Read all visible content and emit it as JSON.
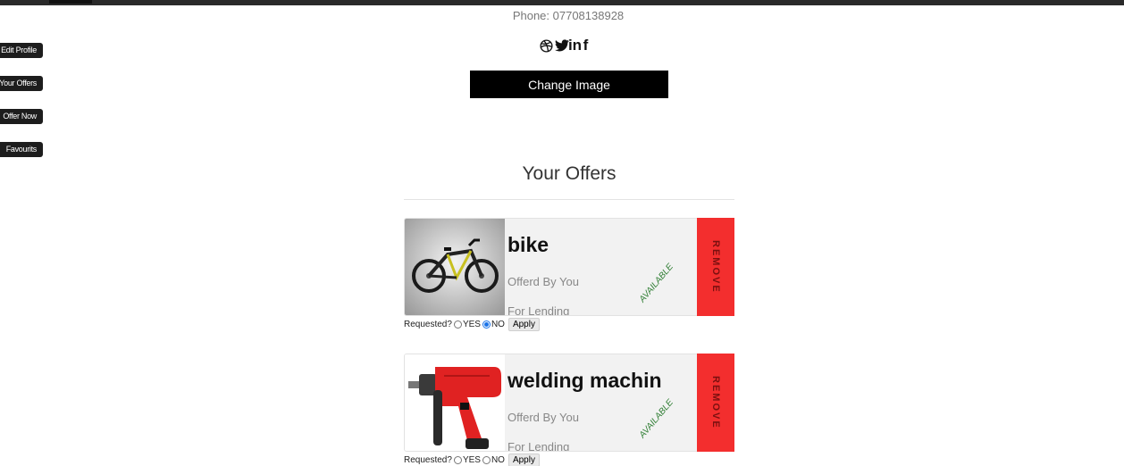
{
  "sidebar": {
    "items": [
      {
        "label": "Edit Profile"
      },
      {
        "label": "Your Offers"
      },
      {
        "label": "Offer Now"
      },
      {
        "label": "Favourits"
      }
    ]
  },
  "profile": {
    "phone": "Phone: 07708138928",
    "social_text": {
      "in": "in",
      "f": "f"
    },
    "change_image_label": "Change Image"
  },
  "offers": {
    "title": "Your Offers",
    "items": [
      {
        "title": "bike",
        "offered_by": "Offerd By You",
        "type": "For Lending",
        "status": "AVAILABLE",
        "remove_label": "REMOVE",
        "requested_label": "Requested?",
        "yes_label": "YES",
        "no_label": "NO",
        "selected": "NO",
        "apply_label": "Apply"
      },
      {
        "title": "welding machin",
        "offered_by": "Offerd By You",
        "type": "For Lending",
        "status": "AVAILABLE",
        "remove_label": "REMOVE",
        "requested_label": "Requested?",
        "yes_label": "YES",
        "no_label": "NO",
        "selected": "",
        "apply_label": "Apply"
      }
    ]
  },
  "colors": {
    "remove": "#f32e2e",
    "available": "#2e7d32",
    "button_dark": "#000000"
  }
}
